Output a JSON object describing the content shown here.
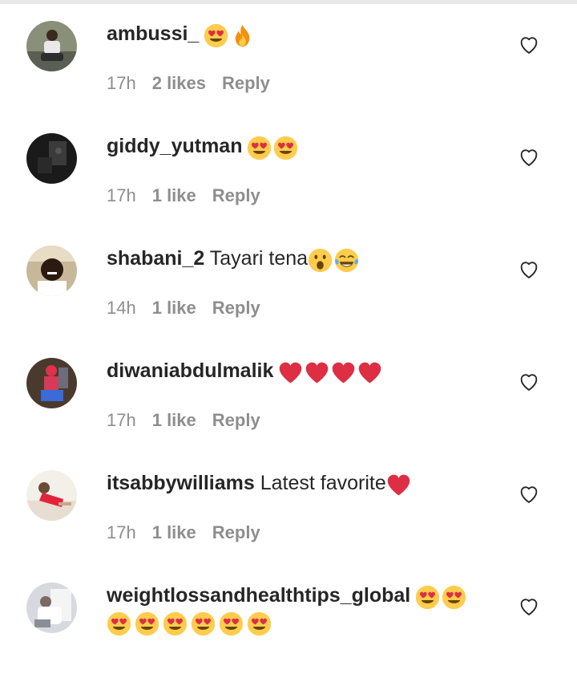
{
  "comments": [
    {
      "username": "ambussi_",
      "text": "",
      "emojis": [
        "smiling-face-heart-eyes",
        "fire"
      ],
      "time": "17h",
      "likes": "2 likes",
      "reply": "Reply",
      "avatar": "avatar-photo-man-on-street"
    },
    {
      "username": "giddy_yutman",
      "text": "",
      "emojis": [
        "smiling-face-heart-eyes",
        "smiling-face-heart-eyes"
      ],
      "time": "17h",
      "likes": "1 like",
      "reply": "Reply",
      "avatar": "avatar-photo-dark-room"
    },
    {
      "username": "shabani_2",
      "text": "Tayari tena",
      "emojis": [
        "face-open-mouth",
        "face-tears-of-joy"
      ],
      "time": "14h",
      "likes": "1 like",
      "reply": "Reply",
      "avatar": "avatar-photo-man-smiling"
    },
    {
      "username": "diwaniabdulmalik",
      "text": "",
      "emojis": [
        "red-heart",
        "red-heart",
        "red-heart",
        "red-heart"
      ],
      "time": "17h",
      "likes": "1 like",
      "reply": "Reply",
      "avatar": "avatar-photo-person-red-cloth"
    },
    {
      "username": "itsabbywilliams",
      "text": "Latest favorite",
      "emojis": [
        "red-heart"
      ],
      "time": "17h",
      "likes": "1 like",
      "reply": "Reply",
      "avatar": "avatar-photo-woman-red-dress"
    },
    {
      "username": "weightlossandhealthtips_global",
      "text": "",
      "emojis": [
        "smiling-face-heart-eyes",
        "smiling-face-heart-eyes"
      ],
      "emojis_line2": [
        "smiling-face-heart-eyes",
        "smiling-face-heart-eyes",
        "smiling-face-heart-eyes",
        "smiling-face-heart-eyes",
        "smiling-face-heart-eyes",
        "smiling-face-heart-eyes"
      ],
      "avatar": "avatar-photo-person-white"
    }
  ],
  "icons": {
    "like": "heart-outline-icon"
  },
  "colors": {
    "meta": "#8e8e8e",
    "text": "#262626",
    "heart_red": "#dd2e44",
    "emoji_yellow": "#ffcc4d"
  }
}
